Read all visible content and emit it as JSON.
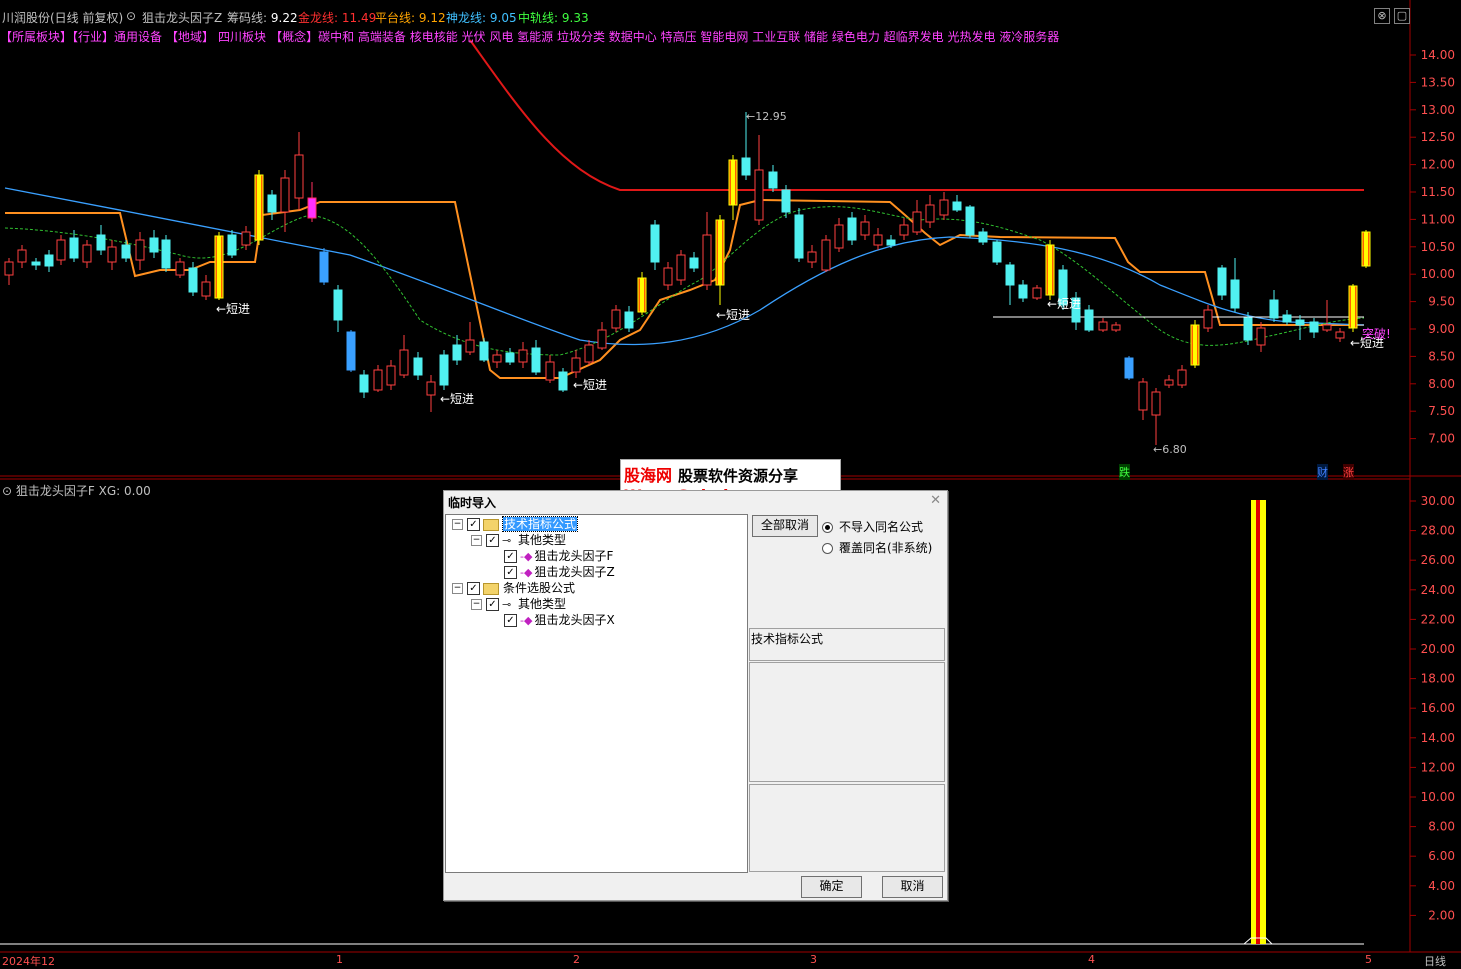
{
  "topbar": {
    "stock": "川润股份(日线 前复权)",
    "indicator": "狙击龙头因子Z",
    "items": [
      {
        "label": "筹码线:",
        "value": "9.22",
        "color": "#ffffff"
      },
      {
        "label": "金龙线:",
        "value": "11.49",
        "color": "#ff3030"
      },
      {
        "label": "平台线:",
        "value": "9.12",
        "color": "#ffa500"
      },
      {
        "label": "神龙线:",
        "value": "9.05",
        "color": "#40c0ff"
      },
      {
        "label": "中轨线:",
        "value": "9.33",
        "color": "#40ff40"
      }
    ]
  },
  "sectors": [
    {
      "text": "【所属板块】【行业】",
      "color": "#ff44ff"
    },
    {
      "text": "通用设备",
      "color": "#ff44ff"
    },
    {
      "text": "【地域】",
      "color": "#ff44ff"
    },
    {
      "text": "四川板块",
      "color": "#ff44ff"
    },
    {
      "text": "【概念】",
      "color": "#ff44ff"
    },
    {
      "text": "碳中和 高端装备 核电核能 光伏 风电 氢能源 垃圾分类 数据中心 特高压 智能电网 工业互联 储能 绿色电力 超临界发电 光热发电 液冷服务器",
      "color": "#ff44ff"
    }
  ],
  "main_axis": {
    "ticks": [
      "14.00",
      "13.50",
      "13.00",
      "12.50",
      "12.00",
      "11.50",
      "11.00",
      "10.50",
      "10.00",
      "9.50",
      "9.00",
      "8.50",
      "8.00",
      "7.50",
      "7.00"
    ]
  },
  "annotations": {
    "high": "12.95",
    "low": "6.80",
    "short_label": "←短进",
    "breakout": "突破!",
    "die": "跌",
    "cai": "财",
    "zhang": "涨"
  },
  "lower": {
    "title": "狙击龙头因子F",
    "xg_label": "XG:",
    "xg_value": "0.00",
    "ticks": [
      "30.00",
      "28.00",
      "26.00",
      "24.00",
      "22.00",
      "20.00",
      "18.00",
      "16.00",
      "14.00",
      "12.00",
      "10.00",
      "8.00",
      "6.00",
      "4.00",
      "2.00"
    ]
  },
  "watermark": {
    "brand": "股海网",
    "slogan": "股票软件资源分享",
    "url": "Www.Guhai.com.cn"
  },
  "dialog": {
    "title": "临时导入",
    "tree": [
      {
        "level": 0,
        "kind": "folder",
        "label": "技术指标公式",
        "selected": true
      },
      {
        "level": 1,
        "kind": "key",
        "label": "其他类型"
      },
      {
        "level": 2,
        "kind": "item",
        "label": "狙击龙头因子F"
      },
      {
        "level": 2,
        "kind": "item",
        "label": "狙击龙头因子Z"
      },
      {
        "level": 0,
        "kind": "folder",
        "label": "条件选股公式"
      },
      {
        "level": 1,
        "kind": "key",
        "label": "其他类型"
      },
      {
        "level": 2,
        "kind": "item",
        "label": "狙击龙头因子X"
      }
    ],
    "deselect_all": "全部取消",
    "radio_no_import": "不导入同名公式",
    "radio_overwrite": "覆盖同名(非系统)",
    "info_label": "技术指标公式",
    "ok": "确定",
    "cancel": "取消"
  },
  "datebar": {
    "labels": [
      "2024年12",
      "1",
      "2",
      "3",
      "4",
      "5"
    ],
    "period": "日线"
  }
}
